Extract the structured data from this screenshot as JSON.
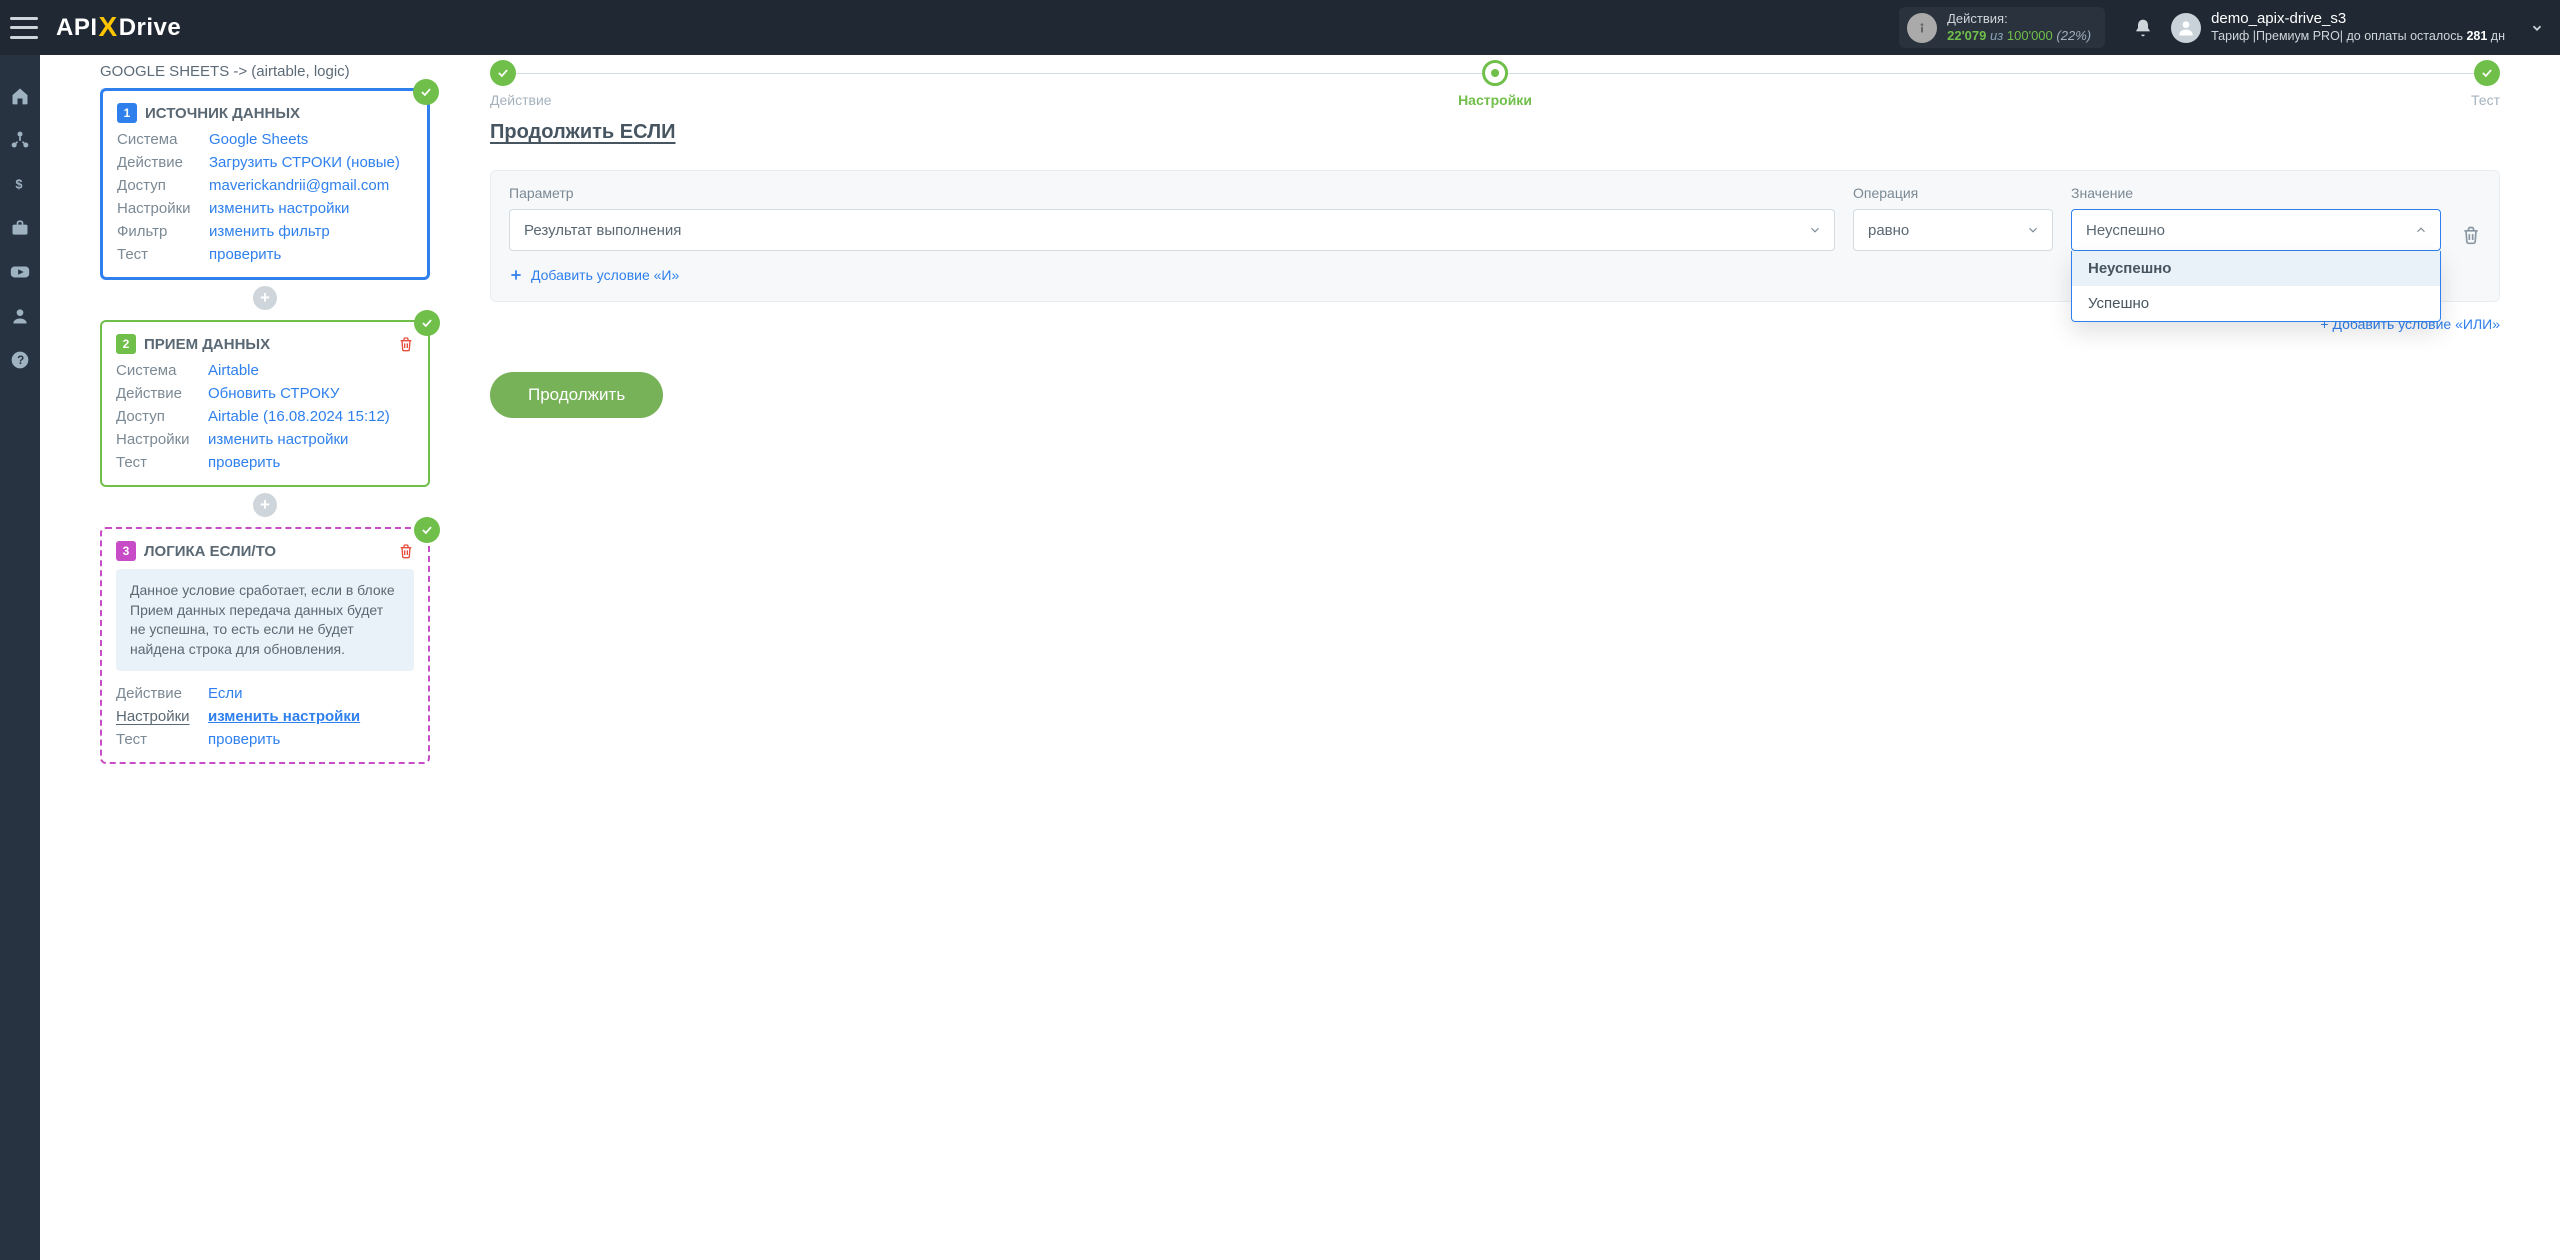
{
  "brand": {
    "part1": "API",
    "part2": "X",
    "part3": "Drive"
  },
  "stats": {
    "title": "Действия:",
    "used": "22'079",
    "sep": "из",
    "total": "100'000",
    "pct": "(22%)"
  },
  "user": {
    "name": "demo_apix-drive_s3",
    "line2_prefix": "Тариф |Премиум PRO| до оплаты осталось ",
    "days": "281",
    "line2_suffix": " дн"
  },
  "crumb": "GOOGLE SHEETS -> (airtable, logic)",
  "cards": {
    "source": {
      "title": "ИСТОЧНИК ДАННЫХ",
      "num": "1",
      "rows": {
        "system_k": "Система",
        "system_v": "Google Sheets",
        "action_k": "Действие",
        "action_v": "Загрузить СТРОКИ (новые)",
        "access_k": "Доступ",
        "access_v": "maverickandrii@gmail.com",
        "settings_k": "Настройки",
        "settings_v": "изменить настройки",
        "filter_k": "Фильтр",
        "filter_v": "изменить фильтр",
        "test_k": "Тест",
        "test_v": "проверить"
      }
    },
    "dest": {
      "title": "ПРИЕМ ДАННЫХ",
      "num": "2",
      "rows": {
        "system_k": "Система",
        "system_v": "Airtable",
        "action_k": "Действие",
        "action_v": "Обновить СТРОКУ",
        "access_k": "Доступ",
        "access_v": "Airtable (16.08.2024 15:12)",
        "settings_k": "Настройки",
        "settings_v": "изменить настройки",
        "test_k": "Тест",
        "test_v": "проверить"
      }
    },
    "logic": {
      "title": "ЛОГИКА ЕСЛИ/ТО",
      "num": "3",
      "hint": "Данное условие сработает, если в блоке Прием данных передача данных будет не успешна, то есть если не будет найдена строка для обновления.",
      "rows": {
        "action_k": "Действие",
        "action_v": "Если",
        "settings_k": "Настройки",
        "settings_v": "изменить настройки",
        "test_k": "Тест",
        "test_v": "проверить"
      }
    }
  },
  "steps": {
    "s1": "Действие",
    "s2": "Настройки",
    "s3": "Тест"
  },
  "main": {
    "title": "Продолжить ЕСЛИ",
    "labels": {
      "param": "Параметр",
      "op": "Операция",
      "value": "Значение"
    },
    "selects": {
      "param": "Результат выполнения",
      "op": "равно",
      "value": "Неуспешно"
    },
    "options": {
      "v1": "Неуспешно",
      "v2": "Успешно"
    },
    "add_and": "Добавить условие «И»",
    "add_or": "+ Добавить условие «ИЛИ»",
    "submit": "Продолжить"
  }
}
